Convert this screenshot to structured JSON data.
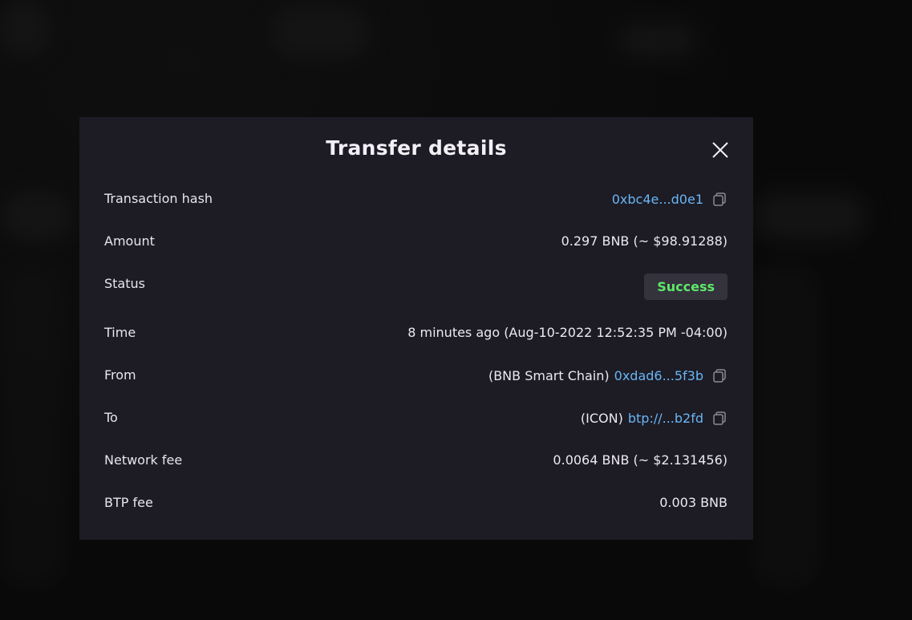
{
  "modal": {
    "title": "Transfer details",
    "close_icon": "close-icon"
  },
  "rows": {
    "tx_hash": {
      "label": "Transaction hash",
      "link": "0xbc4e...d0e1",
      "icon": "copy-icon"
    },
    "amount": {
      "label": "Amount",
      "value": "0.297 BNB (~ $98.91288)"
    },
    "status": {
      "label": "Status",
      "value": "Success",
      "color": "#5ee86a"
    },
    "time": {
      "label": "Time",
      "value": "8 minutes ago (Aug-10-2022 12:52:35 PM -04:00)"
    },
    "from": {
      "label": "From",
      "network": "(BNB Smart Chain)",
      "link": "0xdad6...5f3b",
      "icon": "copy-icon"
    },
    "to": {
      "label": "To",
      "network": "(ICON)",
      "link": "btp://...b2fd",
      "icon": "copy-icon"
    },
    "network_fee": {
      "label": "Network fee",
      "value": "0.0064 BNB (~ $2.131456)"
    },
    "btp_fee": {
      "label": "BTP fee",
      "value": "0.003 BNB"
    }
  },
  "colors": {
    "modal_bg": "#1d1b24",
    "link": "#69b6f5",
    "success": "#5ee86a"
  }
}
